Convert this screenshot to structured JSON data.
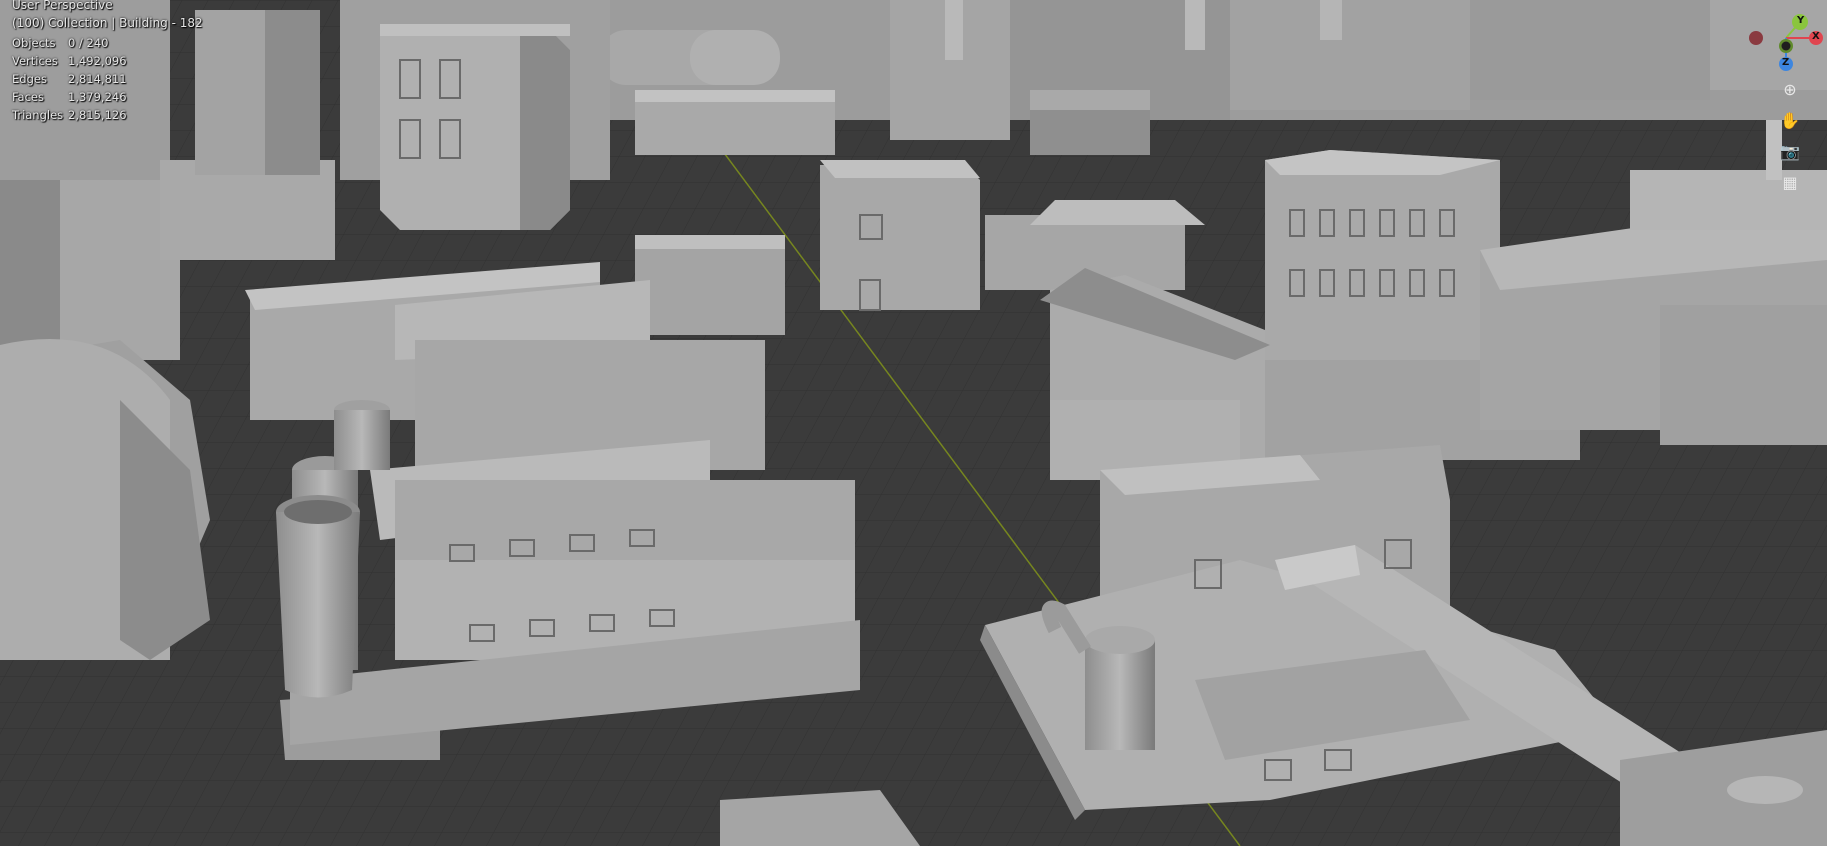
{
  "viewport": {
    "view_name": "User Perspective",
    "collection_line": "(100) Collection | Building - 182"
  },
  "stats": [
    {
      "label": "Objects",
      "value": "0 / 240"
    },
    {
      "label": "Vertices",
      "value": "1,492,096"
    },
    {
      "label": "Edges",
      "value": "2,814,811"
    },
    {
      "label": "Faces",
      "value": "1,379,246"
    },
    {
      "label": "Triangles",
      "value": "2,815,126"
    }
  ],
  "gizmo": {
    "axes": [
      {
        "name": "x",
        "label": "X",
        "color": "#e0454f"
      },
      {
        "name": "y",
        "label": "Y",
        "color": "#8ac53e"
      },
      {
        "name": "z",
        "label": "Z",
        "color": "#3d86e0"
      }
    ]
  },
  "nav_tools": [
    {
      "name": "zoom",
      "icon": "zoom-icon"
    },
    {
      "name": "pan",
      "icon": "hand-icon"
    },
    {
      "name": "camera",
      "icon": "camera-icon"
    },
    {
      "name": "perspective",
      "icon": "grid-icon"
    }
  ],
  "colors": {
    "background": "#3b3b3b",
    "grid_line": "#2e2e2e",
    "y_axis_line": "#7a8a1e",
    "building_light": "#b4b4b4",
    "building_mid": "#9a9a9a",
    "building_dark": "#7a7a7a",
    "building_shadow": "#5f5f5f"
  }
}
